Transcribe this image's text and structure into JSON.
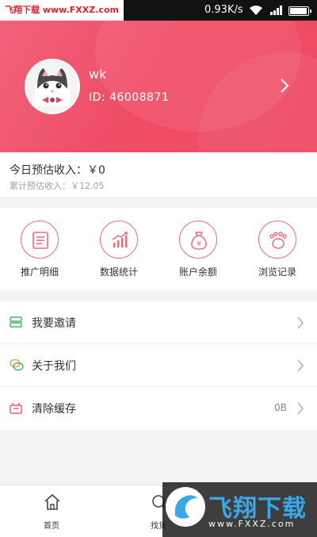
{
  "status_bar": {
    "watermark_text": "飞翔下载 www.FXXZ.com",
    "net_speed": "0.93K/s",
    "icons": [
      "wifi-icon",
      "signal-icon",
      "battery-icon"
    ]
  },
  "profile": {
    "username": "wk",
    "user_id": "ID: 46008871",
    "avatar_icon": "cat-avatar"
  },
  "income": {
    "today": "今日预估收入：￥0",
    "total": "累计预估收入：￥12.05"
  },
  "grid": {
    "items": [
      {
        "label": "推广明细",
        "icon": "document-icon"
      },
      {
        "label": "数据统计",
        "icon": "chart-icon"
      },
      {
        "label": "账户余额",
        "icon": "money-bag-icon"
      },
      {
        "label": "浏览记录",
        "icon": "footprint-icon"
      }
    ]
  },
  "menu": {
    "items": [
      {
        "label": "我要邀请",
        "icon": "invite-icon",
        "value": ""
      },
      {
        "label": "关于我们",
        "icon": "chat-icon",
        "value": ""
      },
      {
        "label": "清除缓存",
        "icon": "cache-icon",
        "value": "0B"
      }
    ]
  },
  "tabbar": {
    "items": [
      {
        "label": "首页",
        "icon": "home-icon"
      },
      {
        "label": "找货",
        "icon": "search-icon"
      }
    ]
  },
  "watermark_bottom": {
    "title": "飞翔下载",
    "url": "www.FXXZ.com"
  },
  "colors": {
    "accent": "#ef4f69",
    "header_gradient_start": "#f1627a",
    "header_gradient_end": "#ee4a62",
    "icon_border": "#ee6a7b"
  }
}
